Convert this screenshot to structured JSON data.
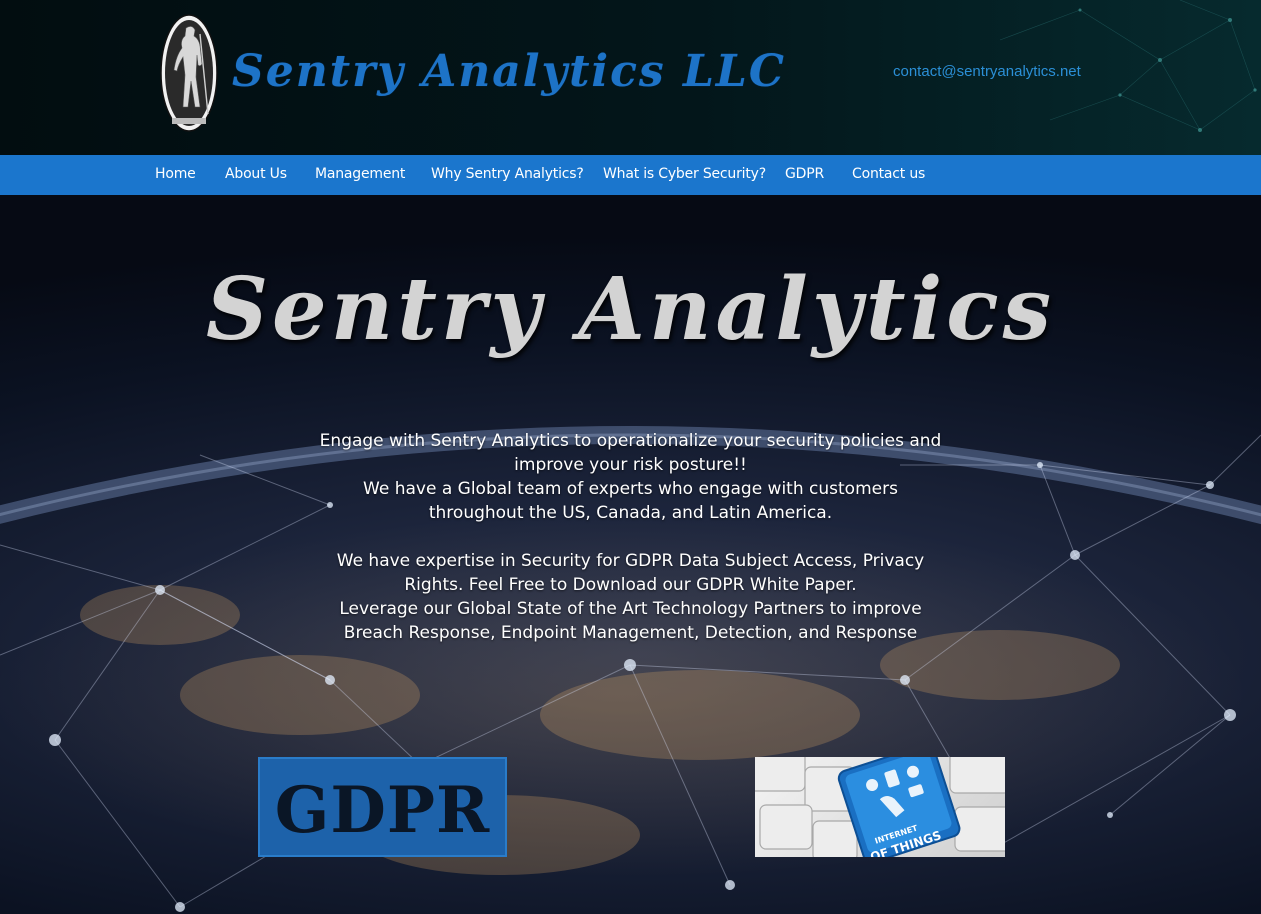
{
  "header": {
    "brand": "Sentry Analytics LLC",
    "contact_email": "contact@sentryanalytics.net"
  },
  "nav": {
    "items": [
      {
        "label": "Home"
      },
      {
        "label": "About Us"
      },
      {
        "label": "Management"
      },
      {
        "label": "Why Sentry Analytics?"
      },
      {
        "label": "What is Cyber Security?"
      },
      {
        "label": "GDPR"
      },
      {
        "label": "Contact us"
      }
    ]
  },
  "hero": {
    "title": "Sentry Analytics",
    "paragraph1": [
      "Engage with Sentry Analytics to operationalize your security policies and",
      "improve your risk posture!!",
      "We have a Global team of experts who engage with customers",
      "throughout the US, Canada, and Latin America."
    ],
    "paragraph2": [
      "We have expertise in Security for GDPR Data Subject Access, Privacy",
      "Rights. Feel Free to Download our GDPR White Paper.",
      "Leverage our Global State of the Art Technology Partners to improve",
      "Breach Response, Endpoint Management,  Detection, and Response"
    ]
  },
  "tiles": {
    "gdpr_label": "GDPR",
    "iot_label_line1": "INTERNET",
    "iot_label_line2": "OF THINGS"
  },
  "colors": {
    "nav_bar": "#1b76cd",
    "brand_blue": "#1d73c7",
    "contact_link": "#2b8fd6"
  },
  "icons": {
    "logo": "minuteman-statue-icon",
    "iot_key": "keyboard-iot-key-icon"
  }
}
